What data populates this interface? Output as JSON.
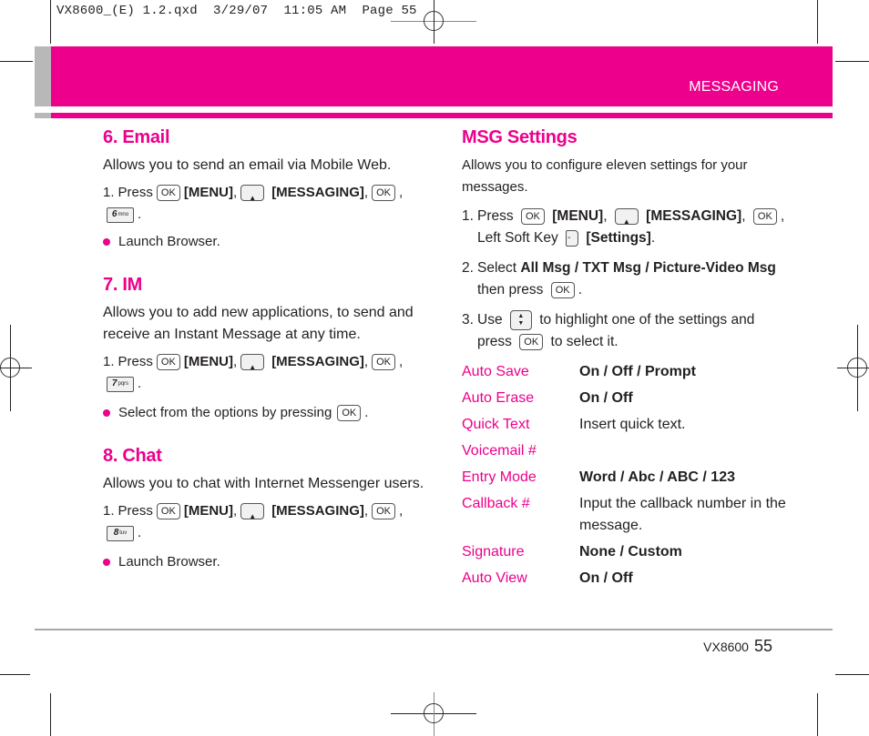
{
  "print_slug": "VX8600_(E) 1.2.qxd  3/29/07  11:05 AM  Page 55",
  "header": {
    "section": "MESSAGING",
    "accent_color": "#ec008c"
  },
  "left": {
    "email": {
      "title": "6. Email",
      "desc": "Allows you to send an email via Mobile Web.",
      "step": {
        "num": "1.",
        "press": "Press",
        "menu": "[MENU]",
        "messaging": "[MESSAGING]",
        "numkey": "6",
        "numkey_sub": "mno"
      },
      "bullet": "Launch Browser."
    },
    "im": {
      "title": "7. IM",
      "desc": "Allows you to add new applications, to send and receive an Instant Message at any time.",
      "step": {
        "num": "1.",
        "press": "Press",
        "menu": "[MENU]",
        "messaging": "[MESSAGING]",
        "numkey": "7",
        "numkey_sub": "pqrs"
      },
      "bullet": "Select from the options by pressing"
    },
    "chat": {
      "title": "8. Chat",
      "desc": "Allows you to chat with Internet Messenger users.",
      "step": {
        "num": "1.",
        "press": "Press",
        "menu": "[MENU]",
        "messaging": "[MESSAGING]",
        "numkey": "8",
        "numkey_sub": "tuv"
      },
      "bullet": "Launch Browser."
    }
  },
  "keys": {
    "ok": "OK",
    "up": "▲",
    "down": "▼",
    "soft": "-"
  },
  "right": {
    "title": "MSG Settings",
    "desc": "Allows you to configure eleven settings for your messages.",
    "steps": [
      {
        "num": "1.",
        "press": "Press",
        "menu": "[MENU]",
        "messaging": "[MESSAGING]",
        "soft_label": "Left Soft Key",
        "settings": "[Settings]"
      },
      {
        "num": "2.",
        "select": "Select",
        "options": "All Msg / TXT Msg / Picture-Video Msg",
        "then": "then press"
      },
      {
        "num": "3.",
        "use": "Use",
        "highlight": "to highlight one of the settings and",
        "press": "press",
        "select_it": "to select it."
      }
    ],
    "settings": [
      {
        "name": "Auto Save",
        "value": "On / Off / Prompt",
        "bold": true
      },
      {
        "name": "Auto Erase",
        "value": "On / Off",
        "bold": true
      },
      {
        "name": "Quick Text",
        "value": "Insert quick text.",
        "bold": false
      },
      {
        "name": "Voicemail #",
        "value": "",
        "bold": false
      },
      {
        "name": "Entry Mode",
        "value": "Word / Abc / ABC / 123",
        "bold": true
      },
      {
        "name": "Callback #",
        "value": "Input the callback number in the message.",
        "bold": false
      },
      {
        "name": "Signature",
        "value": "None / Custom",
        "bold": true
      },
      {
        "name": "Auto View",
        "value": "On / Off",
        "bold": true
      }
    ]
  },
  "footer": {
    "model": "VX8600",
    "page": "55"
  }
}
